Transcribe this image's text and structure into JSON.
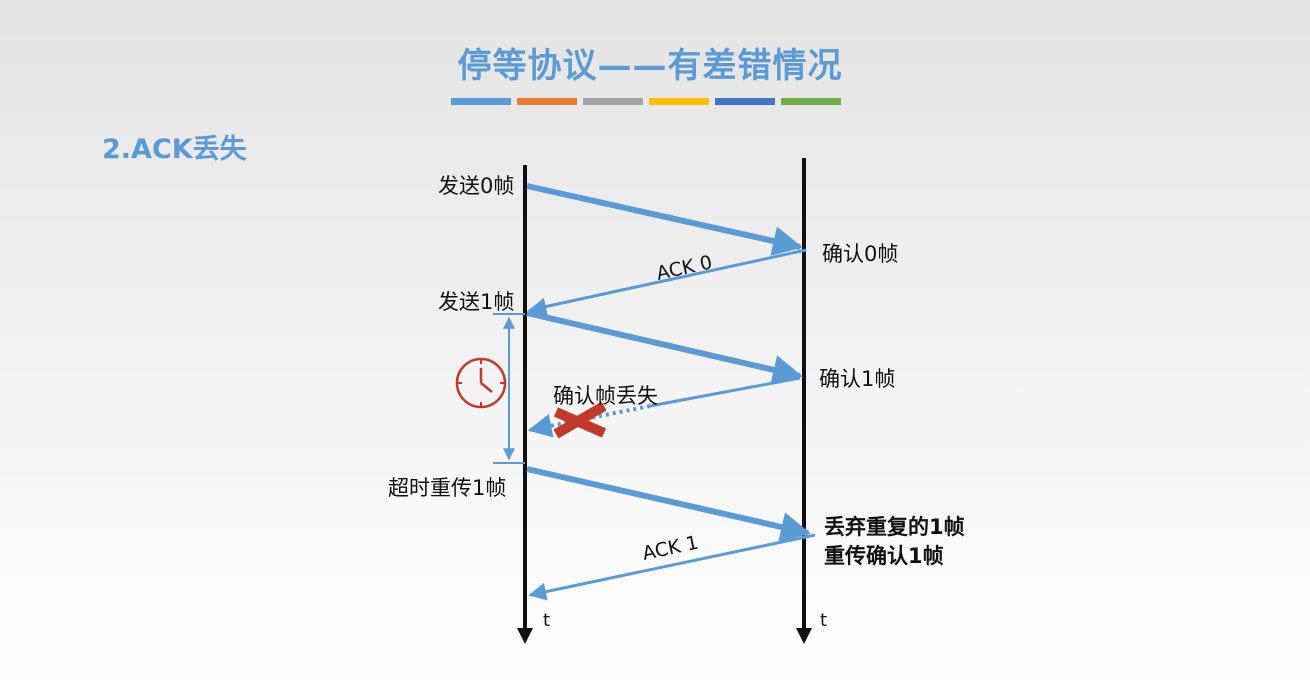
{
  "title": "停等协议——有差错情况",
  "color_bar": [
    "#5b9bd5",
    "#ed7d31",
    "#a5a5a5",
    "#ffc000",
    "#4472c4",
    "#70ad47"
  ],
  "subtitle": "2.ACK丢失",
  "sender": {
    "send_frame0": "发送0帧",
    "send_frame1": "发送1帧",
    "timeout_resend": "超时重传1帧",
    "time_axis": "t"
  },
  "receiver": {
    "confirm_frame0": "确认0帧",
    "confirm_frame1": "确认1帧",
    "discard_dup": "丢弃重复的1帧",
    "resend_ack": "重传确认1帧",
    "time_axis": "t"
  },
  "messages": {
    "ack0": "ACK 0",
    "ack1": "ACK 1",
    "ack_lost": "确认帧丢失"
  },
  "colors": {
    "arrow": "#5b9bd5",
    "timer": "#c0392b",
    "cross": "#c0392b"
  },
  "icons": [
    "clock-icon",
    "cross-icon"
  ]
}
